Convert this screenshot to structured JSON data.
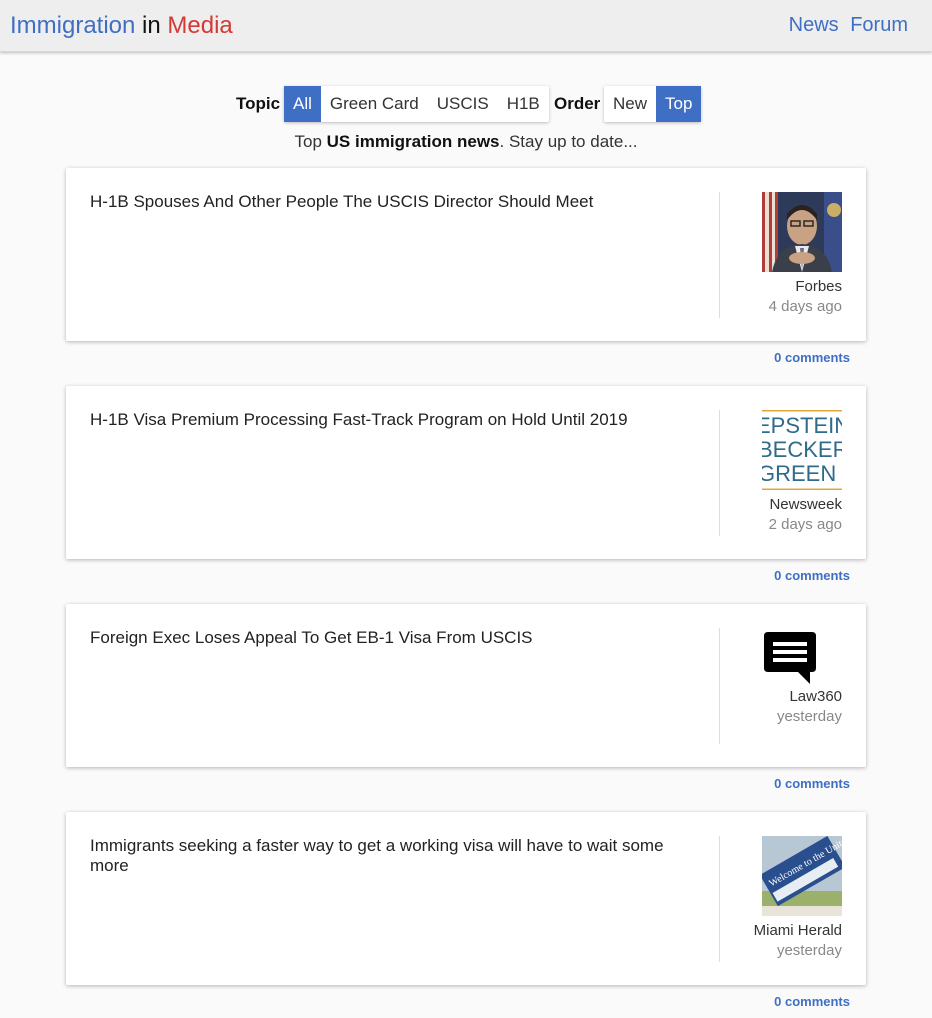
{
  "header": {
    "brand_part1": "Immigration",
    "brand_part2": "in",
    "brand_part3": "Media",
    "nav": [
      "News",
      "Forum"
    ]
  },
  "filters": {
    "topic_label": "Topic",
    "topic_options": [
      "All",
      "Green Card",
      "USCIS",
      "H1B"
    ],
    "topic_selected": "All",
    "order_label": "Order",
    "order_options": [
      "New",
      "Top"
    ],
    "order_selected": "Top"
  },
  "subtitle": {
    "prefix": "Top",
    "bold": "US immigration news",
    "suffix": ". Stay up to date..."
  },
  "articles": [
    {
      "title": "H-1B Spouses And Other People The USCIS Director Should Meet",
      "source": "Forbes",
      "time": "4 days ago",
      "thumb": "portrait-photo",
      "comments": "0 comments"
    },
    {
      "title": "H-1B Visa Premium Processing Fast-Track Program on Hold Until 2019",
      "source": "Newsweek",
      "time": "2 days ago",
      "thumb": "epstein-becker-green-logo",
      "logo_lines": [
        "EPSTEIN",
        "BECKER",
        "GREEN"
      ],
      "comments": "0 comments"
    },
    {
      "title": "Foreign Exec Loses Appeal To Get EB-1 Visa From USCIS",
      "source": "Law360",
      "time": "yesterday",
      "thumb": "chat-bubble-icon",
      "comments": "0 comments"
    },
    {
      "title": "Immigrants seeking a faster way to get a working visa will have to wait some more",
      "source": "Miami Herald",
      "time": "yesterday",
      "thumb": "welcome-card-photo",
      "photo_text": "Welcome to the United States",
      "comments": "0 comments"
    }
  ],
  "colors": {
    "accent": "#3f6fc4",
    "brand_red": "#d33a33"
  }
}
